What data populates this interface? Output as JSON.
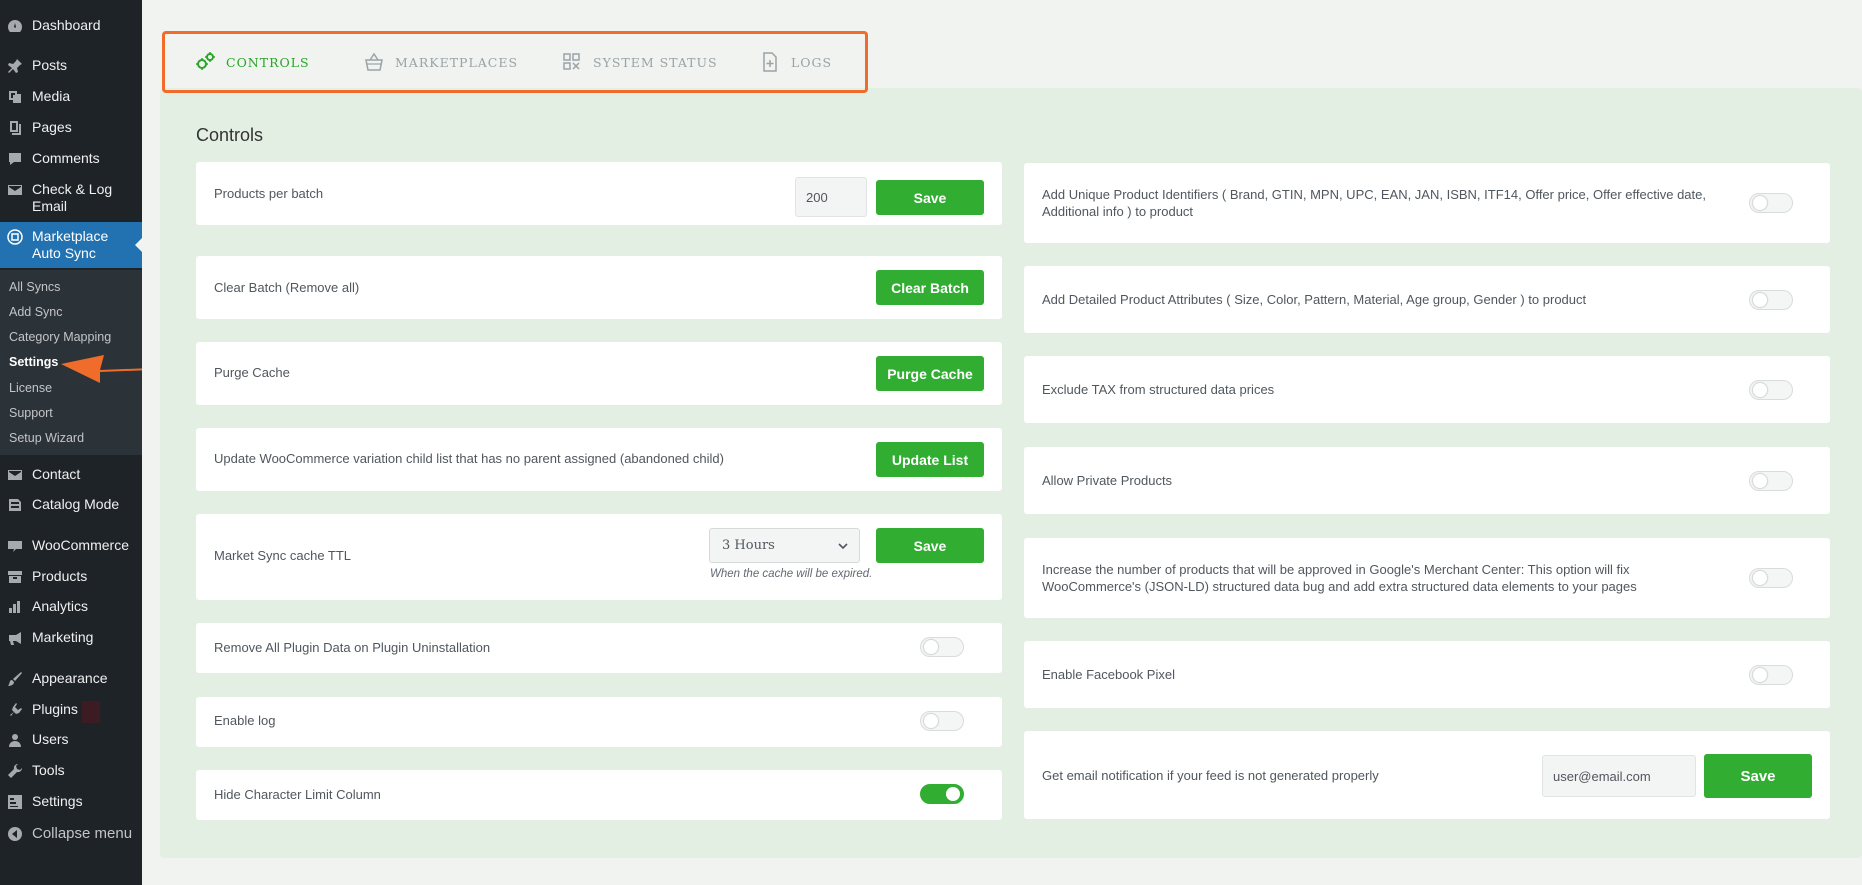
{
  "sidebar": {
    "items": [
      {
        "label": "Dashboard",
        "icon": "dashboard-icon"
      },
      {
        "label": "Posts",
        "icon": "pin-icon"
      },
      {
        "label": "Media",
        "icon": "media-icon"
      },
      {
        "label": "Pages",
        "icon": "pages-icon"
      },
      {
        "label": "Comments",
        "icon": "comment-icon"
      },
      {
        "label": "Check & Log Email",
        "icon": "email-icon"
      },
      {
        "label": "Marketplace Auto Sync",
        "icon": "sync-icon"
      },
      {
        "label": "Contact",
        "icon": "email-icon"
      },
      {
        "label": "Catalog Mode",
        "icon": "catalog-icon"
      },
      {
        "label": "WooCommerce",
        "icon": "woocommerce-icon"
      },
      {
        "label": "Products",
        "icon": "archive-icon"
      },
      {
        "label": "Analytics",
        "icon": "chart-icon"
      },
      {
        "label": "Marketing",
        "icon": "megaphone-icon"
      },
      {
        "label": "Appearance",
        "icon": "brush-icon"
      },
      {
        "label": "Plugins",
        "icon": "plugin-icon"
      },
      {
        "label": "Users",
        "icon": "user-icon"
      },
      {
        "label": "Tools",
        "icon": "wrench-icon"
      },
      {
        "label": "Settings",
        "icon": "settings-icon"
      },
      {
        "label": "Collapse menu",
        "icon": "collapse-icon"
      }
    ],
    "submenu": [
      "All Syncs",
      "Add Sync",
      "Category Mapping",
      "Settings",
      "License",
      "Support",
      "Setup Wizard"
    ]
  },
  "tabs": [
    {
      "label": "CONTROLS",
      "icon": "gears-icon"
    },
    {
      "label": "MARKETPLACES",
      "icon": "basket-icon"
    },
    {
      "label": "SYSTEM STATUS",
      "icon": "status-icon"
    },
    {
      "label": "LOGS",
      "icon": "log-file-icon"
    }
  ],
  "panel": {
    "title": "Controls"
  },
  "left": {
    "products_per_batch": {
      "label": "Products per batch",
      "value": "200",
      "button": "Save"
    },
    "clear_batch": {
      "label": "Clear Batch (Remove all)",
      "button": "Clear Batch"
    },
    "purge_cache": {
      "label": "Purge Cache",
      "button": "Purge Cache"
    },
    "update_list": {
      "label": "Update WooCommerce variation child list that has no parent assigned (abandoned child)",
      "button": "Update List"
    },
    "cache_ttl": {
      "label": "Market Sync cache TTL",
      "select": "3 Hours",
      "hint": "When the cache will be expired.",
      "button": "Save"
    },
    "remove_data": {
      "label": "Remove All Plugin Data on Plugin Uninstallation",
      "enabled": false
    },
    "enable_log": {
      "label": "Enable log",
      "enabled": false
    },
    "hide_char": {
      "label": "Hide Character Limit Column",
      "enabled": true
    }
  },
  "right": {
    "unique_ids": {
      "label": "Add Unique Product Identifiers ( Brand, GTIN, MPN, UPC, EAN, JAN, ISBN, ITF14, Offer price, Offer effective date, Additional info ) to product",
      "enabled": false
    },
    "detailed_attrs": {
      "label": "Add Detailed Product Attributes ( Size, Color, Pattern, Material, Age group, Gender ) to product",
      "enabled": false
    },
    "exclude_tax": {
      "label": "Exclude TAX from structured data prices",
      "enabled": false
    },
    "private_products": {
      "label": "Allow Private Products",
      "enabled": false
    },
    "merchant_center": {
      "label": "Increase the number of products that will be approved in Google's Merchant Center: This option will fix WooCommerce's (JSON-LD) structured data bug and add extra structured data elements to your pages",
      "enabled": false
    },
    "facebook_pixel": {
      "label": "Enable Facebook Pixel",
      "enabled": false
    },
    "email_notify": {
      "label": "Get email notification if your feed is not generated properly",
      "value": "user@email.com",
      "button": "Save"
    }
  },
  "colors": {
    "accent": "#31ad32",
    "highlight": "#ef6c2a",
    "sidebar": "#1d2327",
    "active_menu": "#2271b1"
  }
}
